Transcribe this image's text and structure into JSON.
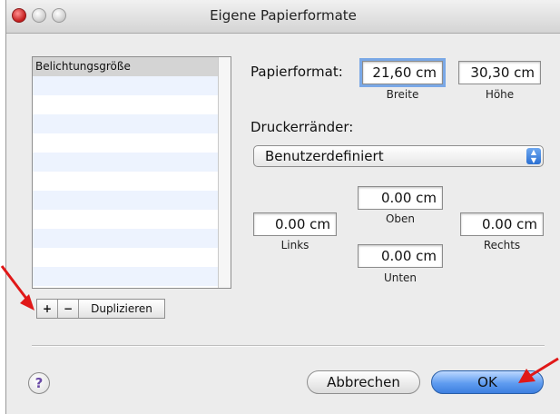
{
  "window": {
    "title": "Eigene Papierformate"
  },
  "list": {
    "items": [
      "Belichtungsgröße",
      "",
      "",
      "",
      "",
      "",
      "",
      "",
      "",
      "",
      "",
      ""
    ]
  },
  "list_buttons": {
    "add": "+",
    "remove": "−",
    "duplicate": "Duplizieren"
  },
  "paper": {
    "label": "Papierformat:",
    "width_value": "21,60 cm",
    "height_value": "30,30 cm",
    "width_caption": "Breite",
    "height_caption": "Höhe"
  },
  "margins": {
    "label": "Druckerränder:",
    "preset": "Benutzerdefiniert",
    "top_value": "0.00 cm",
    "top_caption": "Oben",
    "left_value": "0.00 cm",
    "left_caption": "Links",
    "right_value": "0.00 cm",
    "right_caption": "Rechts",
    "bottom_value": "0.00 cm",
    "bottom_caption": "Unten"
  },
  "footer": {
    "help": "?",
    "cancel": "Abbrechen",
    "ok": "OK"
  },
  "colors": {
    "annotation_arrow": "#e01818",
    "focus_ring": "#7aa8e6",
    "default_button": "#3d7fe0"
  }
}
